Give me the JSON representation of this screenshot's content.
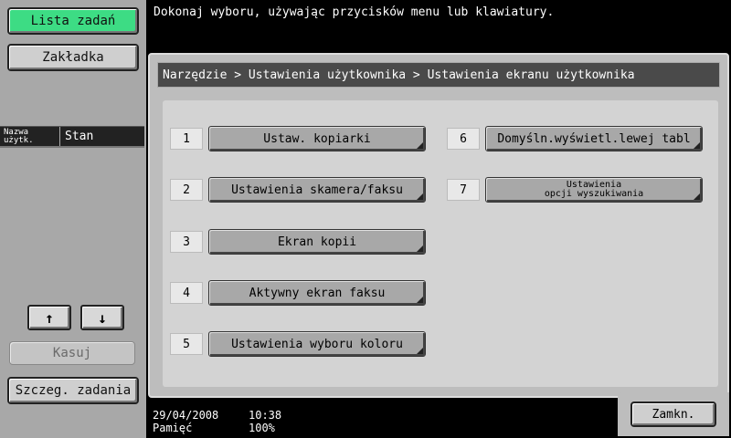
{
  "sidebar": {
    "job_list_label": "Lista zadań",
    "bookmark_label": "Zakładka",
    "user_name_header": "Nazwa\nużytk.",
    "status_header": "Stan",
    "up_arrow": "↑",
    "down_arrow": "↓",
    "delete_label": "Kasuj",
    "details_label": "Szczeg. zadania"
  },
  "message": "Dokonaj wyboru, używając przycisków menu lub klawiatury.",
  "breadcrumb": "Narzędzie > Ustawienia użytkownika > Ustawienia ekranu użytkownika",
  "menu": [
    {
      "num": "1",
      "label": "Ustaw. kopiarki"
    },
    {
      "num": "2",
      "label": "Ustawienia skamera/faksu"
    },
    {
      "num": "3",
      "label": "Ekran kopii"
    },
    {
      "num": "4",
      "label": "Aktywny ekran faksu"
    },
    {
      "num": "5",
      "label": "Ustawienia wyboru koloru"
    },
    {
      "num": "6",
      "label": "Domyśln.wyświetl.lewej tabl"
    },
    {
      "num": "7",
      "label": "Ustawienia\nopcji wyszukiwania"
    }
  ],
  "status": {
    "date": "29/04/2008",
    "time": "10:38",
    "memory_label": "Pamięć",
    "memory_value": "100%"
  },
  "close_label": "Zamkn."
}
